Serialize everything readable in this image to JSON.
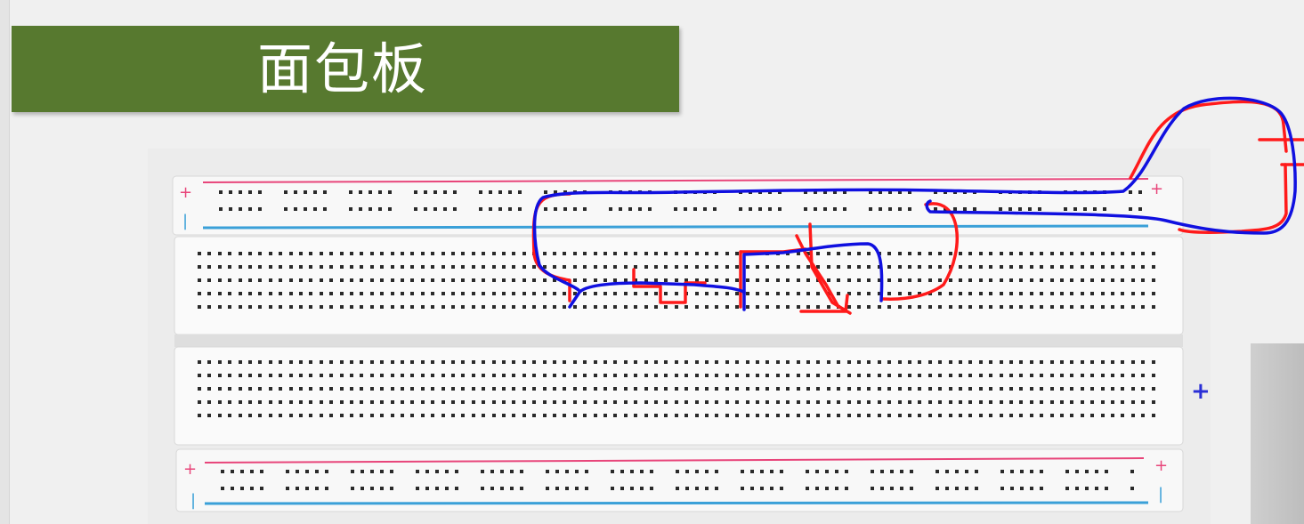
{
  "slide": {
    "title": "面包板",
    "banner_color": "#57792f"
  },
  "breadboard": {
    "rail_plus_symbol": "+",
    "rail_minus_symbol": "|",
    "rail_red_color": "#e8457a",
    "rail_blue_color": "#3aa0d8",
    "annotation_plus": "+"
  },
  "annotations": {
    "red_ink_color": "#ff1a1a",
    "blue_ink_color": "#1010e0"
  }
}
